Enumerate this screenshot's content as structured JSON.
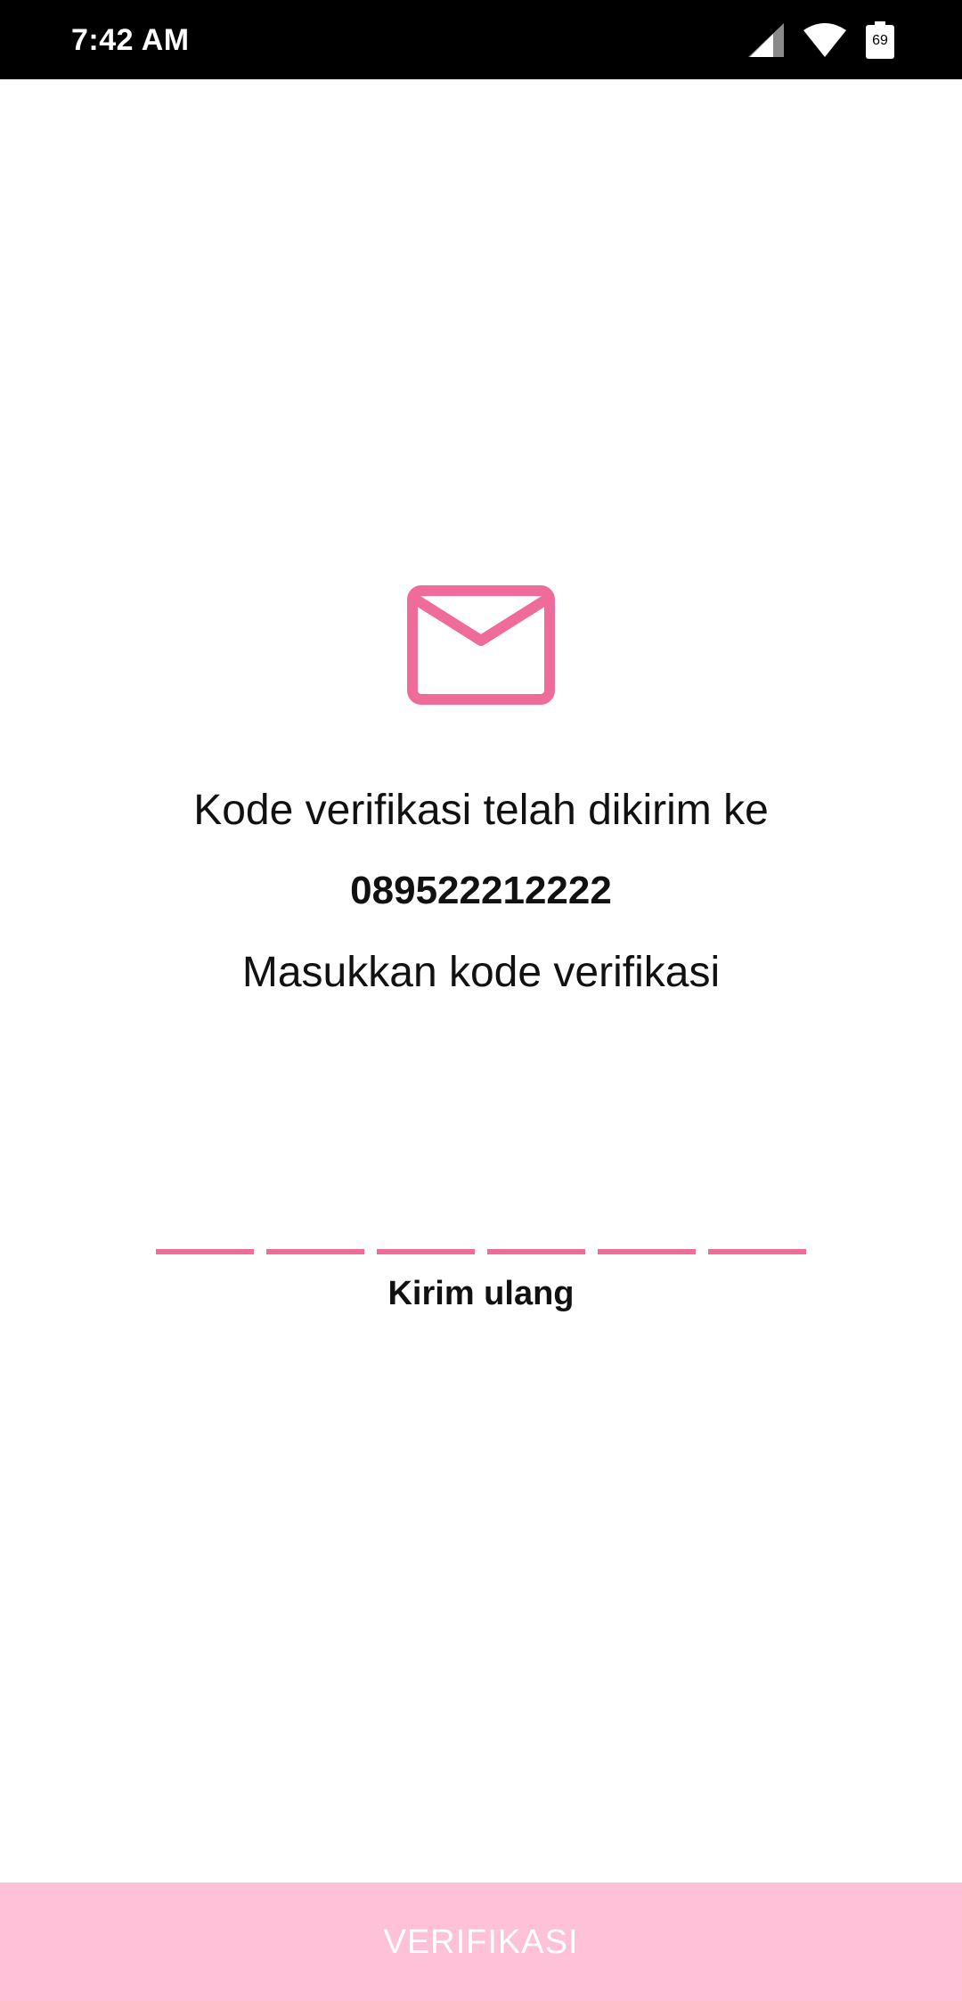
{
  "status_bar": {
    "time": "7:42 AM",
    "battery_level": "69",
    "icons": [
      "cellular-signal-icon",
      "wifi-icon",
      "battery-icon"
    ]
  },
  "verification": {
    "icon": "mail-icon",
    "sent_message": "Kode verifikasi telah dikirim ke",
    "phone_number": "089522212222",
    "prompt": "Masukkan kode verifikasi",
    "code_length": 6,
    "resend_label": "Kirim ulang"
  },
  "footer": {
    "verify_label": "VERIFIKASI"
  },
  "colors": {
    "accent": "#EE6B9A",
    "button_background": "#FEC1D7",
    "button_text": "#FFFFFF",
    "status_bar": "#000000"
  }
}
